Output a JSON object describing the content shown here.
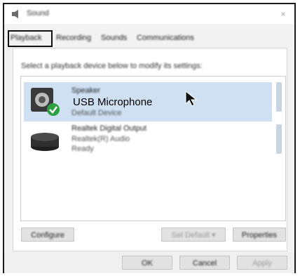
{
  "window": {
    "title": "Sound",
    "close_glyph": "×"
  },
  "tabs": [
    {
      "label": "Playback"
    },
    {
      "label": "Recording"
    },
    {
      "label": "Sounds"
    },
    {
      "label": "Communications"
    }
  ],
  "instruction": "Select a playback device below to modify its settings:",
  "devices": [
    {
      "name": "Speaker",
      "annotation": "USB Microphone",
      "status": "Default Device",
      "icon": "speaker-icon",
      "selected": true
    },
    {
      "name": "Realtek Digital Output",
      "driver": "Realtek(R) Audio",
      "status": "Ready",
      "icon": "digital-output-icon",
      "selected": false
    }
  ],
  "buttons": {
    "configure": "Configure",
    "set_default": "Set Default ▾",
    "properties": "Properties",
    "ok": "OK",
    "cancel": "Cancel",
    "apply": "Apply"
  },
  "colors": {
    "selection": "#cfe0f2",
    "default_check": "#2ea043",
    "highlight_border": "#111111"
  }
}
